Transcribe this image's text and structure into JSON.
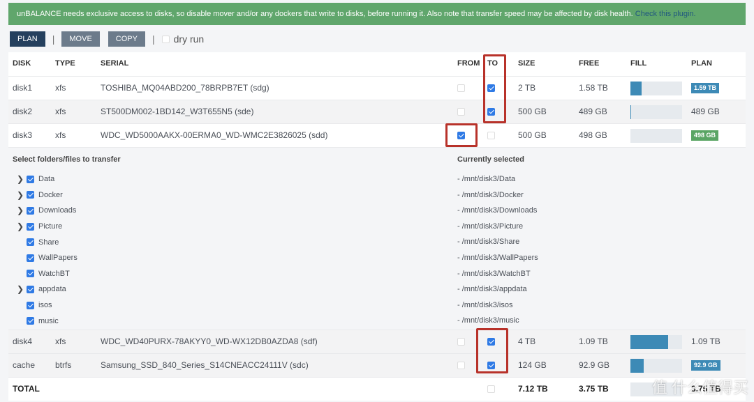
{
  "banner": {
    "text": "unBALANCE needs exclusive access to disks, so disable mover and/or any dockers that write to disks, before running it. Also note that transfer speed may be affected by disk health. ",
    "link": "Check this plugin."
  },
  "toolbar": {
    "plan": "PLAN",
    "move": "MOVE",
    "copy": "COPY",
    "separator": "|",
    "dry_run": "dry run",
    "dry_run_checked": false
  },
  "columns": [
    "DISK",
    "TYPE",
    "SERIAL",
    "FROM",
    "TO",
    "SIZE",
    "FREE",
    "FILL",
    "PLAN"
  ],
  "disks": [
    {
      "disk": "disk1",
      "type": "xfs",
      "serial": "TOSHIBA_MQ04ABD200_78BRPB7ET (sdg)",
      "from": false,
      "to": true,
      "size": "2 TB",
      "free": "1.58 TB",
      "fill_pct": 21,
      "plan": "1.59 TB",
      "plan_badge": "#3d8ab6"
    },
    {
      "disk": "disk2",
      "type": "xfs",
      "serial": "ST500DM002-1BD142_W3T655N5 (sde)",
      "from": false,
      "to": true,
      "size": "500 GB",
      "free": "489 GB",
      "fill_pct": 2,
      "plan": "489 GB",
      "plan_badge": null
    },
    {
      "disk": "disk3",
      "type": "xfs",
      "serial": "WDC_WD5000AAKX-00ERMA0_WD-WMC2E3826025 (sdd)",
      "from": true,
      "to": false,
      "size": "500 GB",
      "free": "498 GB",
      "fill_pct": 0,
      "plan": "498 GB",
      "plan_badge": "#5aa564"
    },
    {
      "disk": "disk4",
      "type": "xfs",
      "serial": "WDC_WD40PURX-78AKYY0_WD-WX12DB0AZDA8 (sdf)",
      "from": false,
      "to": true,
      "size": "4 TB",
      "free": "1.09 TB",
      "fill_pct": 73,
      "plan": "1.09 TB",
      "plan_badge": null
    },
    {
      "disk": "cache",
      "type": "btrfs",
      "serial": "Samsung_SSD_840_Series_S14CNEACC24111V (sdc)",
      "from": false,
      "to": true,
      "size": "124 GB",
      "free": "92.9 GB",
      "fill_pct": 25,
      "plan": "92.9 GB",
      "plan_badge": "#3d8ab6"
    }
  ],
  "panel": {
    "title": "Select folders/files to transfer",
    "selected_title": "Currently selected",
    "folders": [
      {
        "name": "Data",
        "expandable": true,
        "checked": true
      },
      {
        "name": "Docker",
        "expandable": true,
        "checked": true
      },
      {
        "name": "Downloads",
        "expandable": true,
        "checked": true
      },
      {
        "name": "Picture",
        "expandable": true,
        "checked": true
      },
      {
        "name": "Share",
        "expandable": false,
        "checked": true
      },
      {
        "name": "WallPapers",
        "expandable": false,
        "checked": true
      },
      {
        "name": "WatchBT",
        "expandable": false,
        "checked": true
      },
      {
        "name": "appdata",
        "expandable": true,
        "checked": true
      },
      {
        "name": "isos",
        "expandable": false,
        "checked": true
      },
      {
        "name": "music",
        "expandable": false,
        "checked": true
      }
    ],
    "selected": [
      "- /mnt/disk3/Data",
      "- /mnt/disk3/Docker",
      "- /mnt/disk3/Downloads",
      "- /mnt/disk3/Picture",
      "- /mnt/disk3/Share",
      "- /mnt/disk3/WallPapers",
      "- /mnt/disk3/WatchBT",
      "- /mnt/disk3/appdata",
      "- /mnt/disk3/isos",
      "- /mnt/disk3/music"
    ]
  },
  "total": {
    "label": "TOTAL",
    "size": "7.12 TB",
    "free": "3.75 TB",
    "plan": "3.75 TB",
    "fill_pct": 0
  },
  "watermark": "值 什么值得买"
}
